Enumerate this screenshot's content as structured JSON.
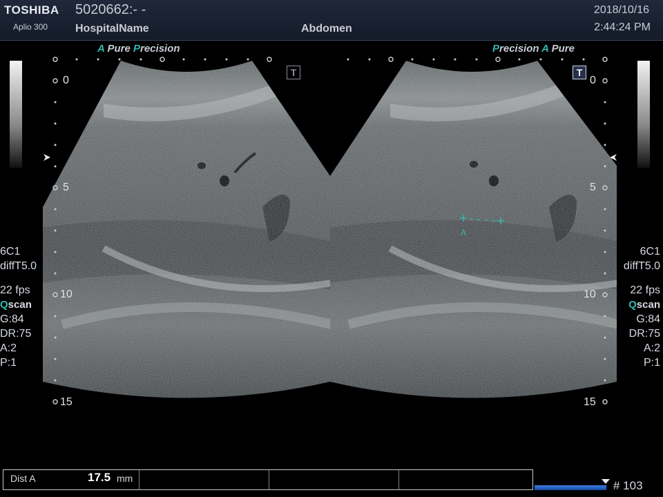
{
  "header": {
    "brand": "TOSHIBA",
    "model": "Aplio 300",
    "patient_id": "5020662:- -",
    "hospital": "HospitalName",
    "preset": "Abdomen",
    "date": "2018/10/16",
    "time": "2:44:24 PM"
  },
  "left_image": {
    "mode_a": "A",
    "mode_pure": "Pure",
    "mode_p": "P",
    "mode_precision": "recision",
    "t_icon": "T",
    "depth_marks": [
      "0",
      "5",
      "10",
      "15"
    ],
    "params": {
      "probe": "6C1",
      "freq": "diffT5.0",
      "fps": "22 fps",
      "q_letter": "Q",
      "scan": "scan",
      "gain": "G:84",
      "dr": "DR:75",
      "a": "A:2",
      "p": "P:1"
    }
  },
  "right_image": {
    "mode_p": "P",
    "mode_precision": "recision",
    "mode_a": "A",
    "mode_pure": "Pure",
    "t_icon": "T",
    "depth_marks": [
      "0",
      "5",
      "10",
      "15"
    ],
    "caliper_label": "A",
    "params": {
      "probe": "6C1",
      "freq": "diffT5.0",
      "fps": "22 fps",
      "q_letter": "Q",
      "scan": "scan",
      "gain": "G:84",
      "dr": "DR:75",
      "a": "A:2",
      "p": "P:1"
    }
  },
  "measurement": {
    "name": "Dist A",
    "value": "17.5",
    "unit": "mm"
  },
  "cine": {
    "frame": "# 103"
  },
  "colors": {
    "accent": "#2fb8b0",
    "header_bg": "#1a2131",
    "cine_bar": "#2a64c8"
  }
}
